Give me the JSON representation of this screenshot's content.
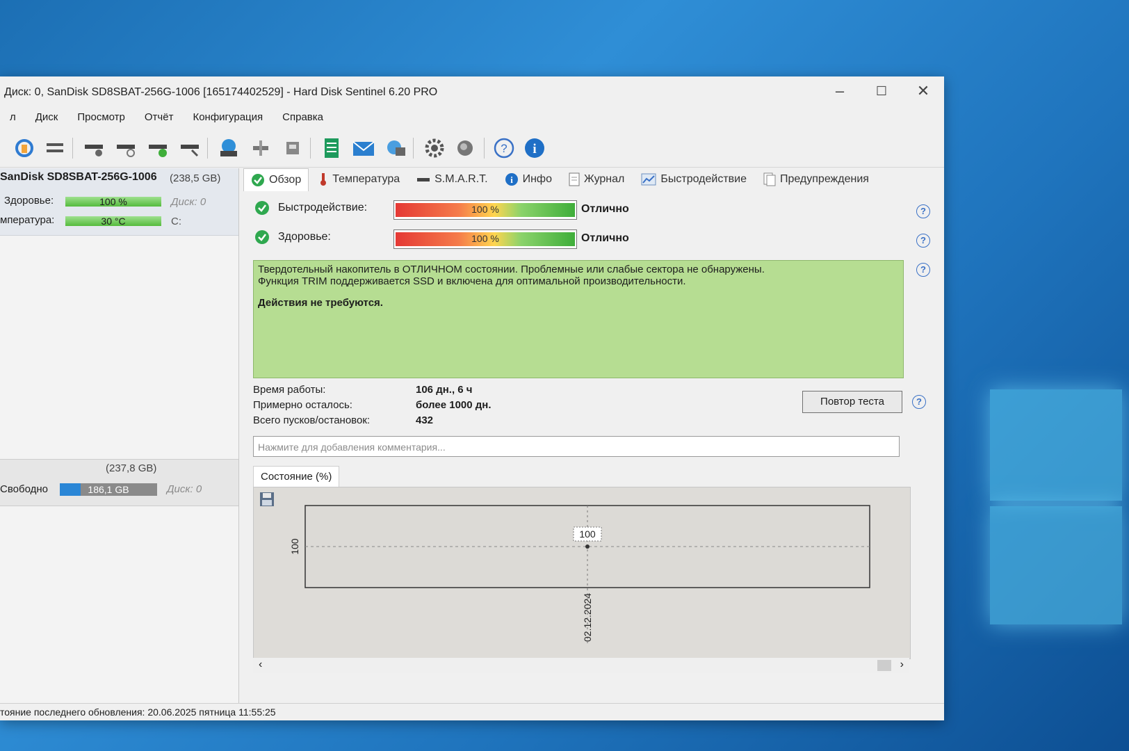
{
  "window": {
    "title": "Диск: 0, SanDisk SD8SBAT-256G-1006 [165174402529]  -  Hard Disk Sentinel 6.20 PRO"
  },
  "menu": [
    "л",
    "Диск",
    "Просмотр",
    "Отчёт",
    "Конфигурация",
    "Справка"
  ],
  "left_panel": {
    "disk_name": "SanDisk SD8SBAT-256G-1006",
    "disk_size": "(238,5 GB)",
    "health_label": "Здоровье:",
    "health_value": "100 %",
    "health_disk": "Диск: 0",
    "temp_label": "мпература:",
    "temp_value": "30 °C",
    "temp_drive": "C:",
    "volume_size": "(237,8 GB)",
    "free_label": "Свободно",
    "free_value": "186,1 GB",
    "free_disk": "Диск: 0"
  },
  "tabs": [
    {
      "label": "Обзор",
      "icon": "check-icon"
    },
    {
      "label": "Температура",
      "icon": "thermometer-icon"
    },
    {
      "label": "S.M.A.R.T.",
      "icon": "smart-icon"
    },
    {
      "label": "Инфо",
      "icon": "info-icon"
    },
    {
      "label": "Журнал",
      "icon": "document-icon"
    },
    {
      "label": "Быстродействие",
      "icon": "chart-icon"
    },
    {
      "label": "Предупреждения",
      "icon": "warning-doc-icon"
    }
  ],
  "overview": {
    "performance_label": "Быстродействие:",
    "performance_value": "100 %",
    "performance_status": "Отлично",
    "health_label": "Здоровье:",
    "health_value": "100 %",
    "health_status": "Отлично",
    "message_line1": "Твердотельный накопитель в ОТЛИЧНОМ состоянии. Проблемные или слабые сектора не обнаружены.",
    "message_line2": "Функция TRIM поддерживается SSD и включена для оптимальной производительности.",
    "message_action": "Действия не требуются.",
    "uptime_label": "Время работы:",
    "uptime_value": "106 дн., 6 ч",
    "remaining_label": "Примерно осталось:",
    "remaining_value": "более 1000 дн.",
    "starts_label": "Всего пусков/остановок:",
    "starts_value": "432",
    "retest_button": "Повтор теста",
    "comment_placeholder": "Нажмите для добавления комментария..."
  },
  "graph": {
    "tab_label": "Состояние (%)",
    "y_tick": "100",
    "point_label": "100",
    "x_tick": "02.12.2024"
  },
  "chart_data": {
    "type": "line",
    "x": [
      "02.12.2024"
    ],
    "series": [
      {
        "values": [
          100
        ]
      }
    ]
  },
  "status_bar": "тояние последнего обновления: 20.06.2025 пятница 11:55:25",
  "colors": {
    "accent": "#3a71c6",
    "ok_green": "#3fae3a",
    "message_bg": "#b6dd92"
  }
}
